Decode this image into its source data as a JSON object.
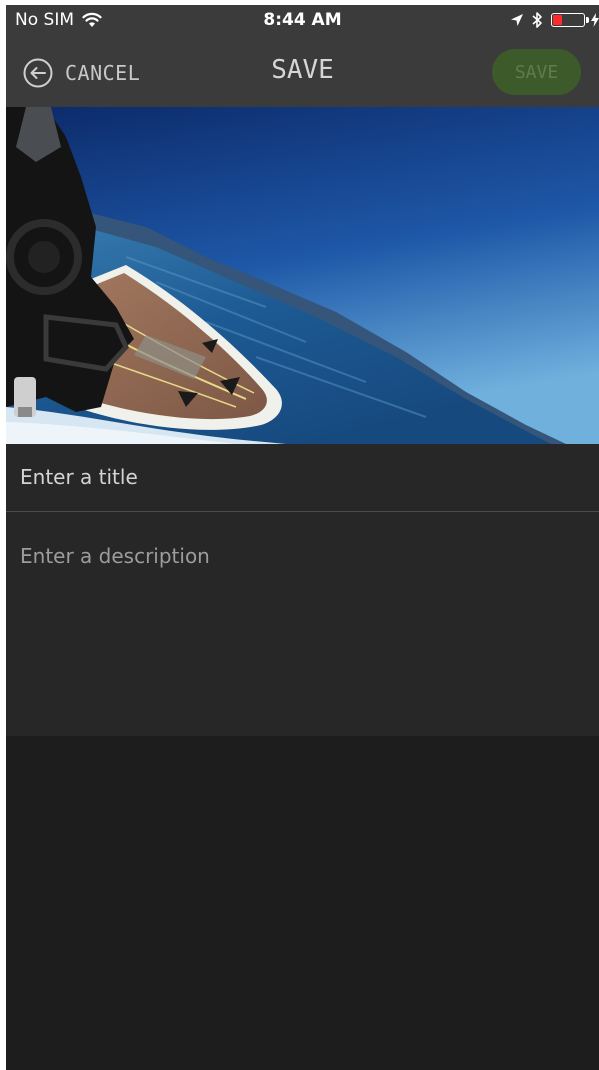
{
  "status_bar": {
    "carrier": "No SIM",
    "time": "8:44 AM",
    "battery_level": 0.35,
    "battery_color": "#ff2a2a"
  },
  "nav": {
    "cancel_label": "CANCEL",
    "cancel_icon": "arrow-left-circle-icon",
    "title": "SAVE",
    "save_label": "SAVE",
    "save_enabled": false,
    "save_color": "#3d5a2b"
  },
  "media": {
    "description": "Action-camera photo of a wakesurf board on a lake"
  },
  "form": {
    "title_placeholder": "Enter a title",
    "title_value": "",
    "description_placeholder": "Enter a description",
    "description_value": ""
  },
  "colors": {
    "bar_background": "#3b3b3b",
    "screen_background": "#1d1d1d",
    "field_background": "#272727"
  }
}
